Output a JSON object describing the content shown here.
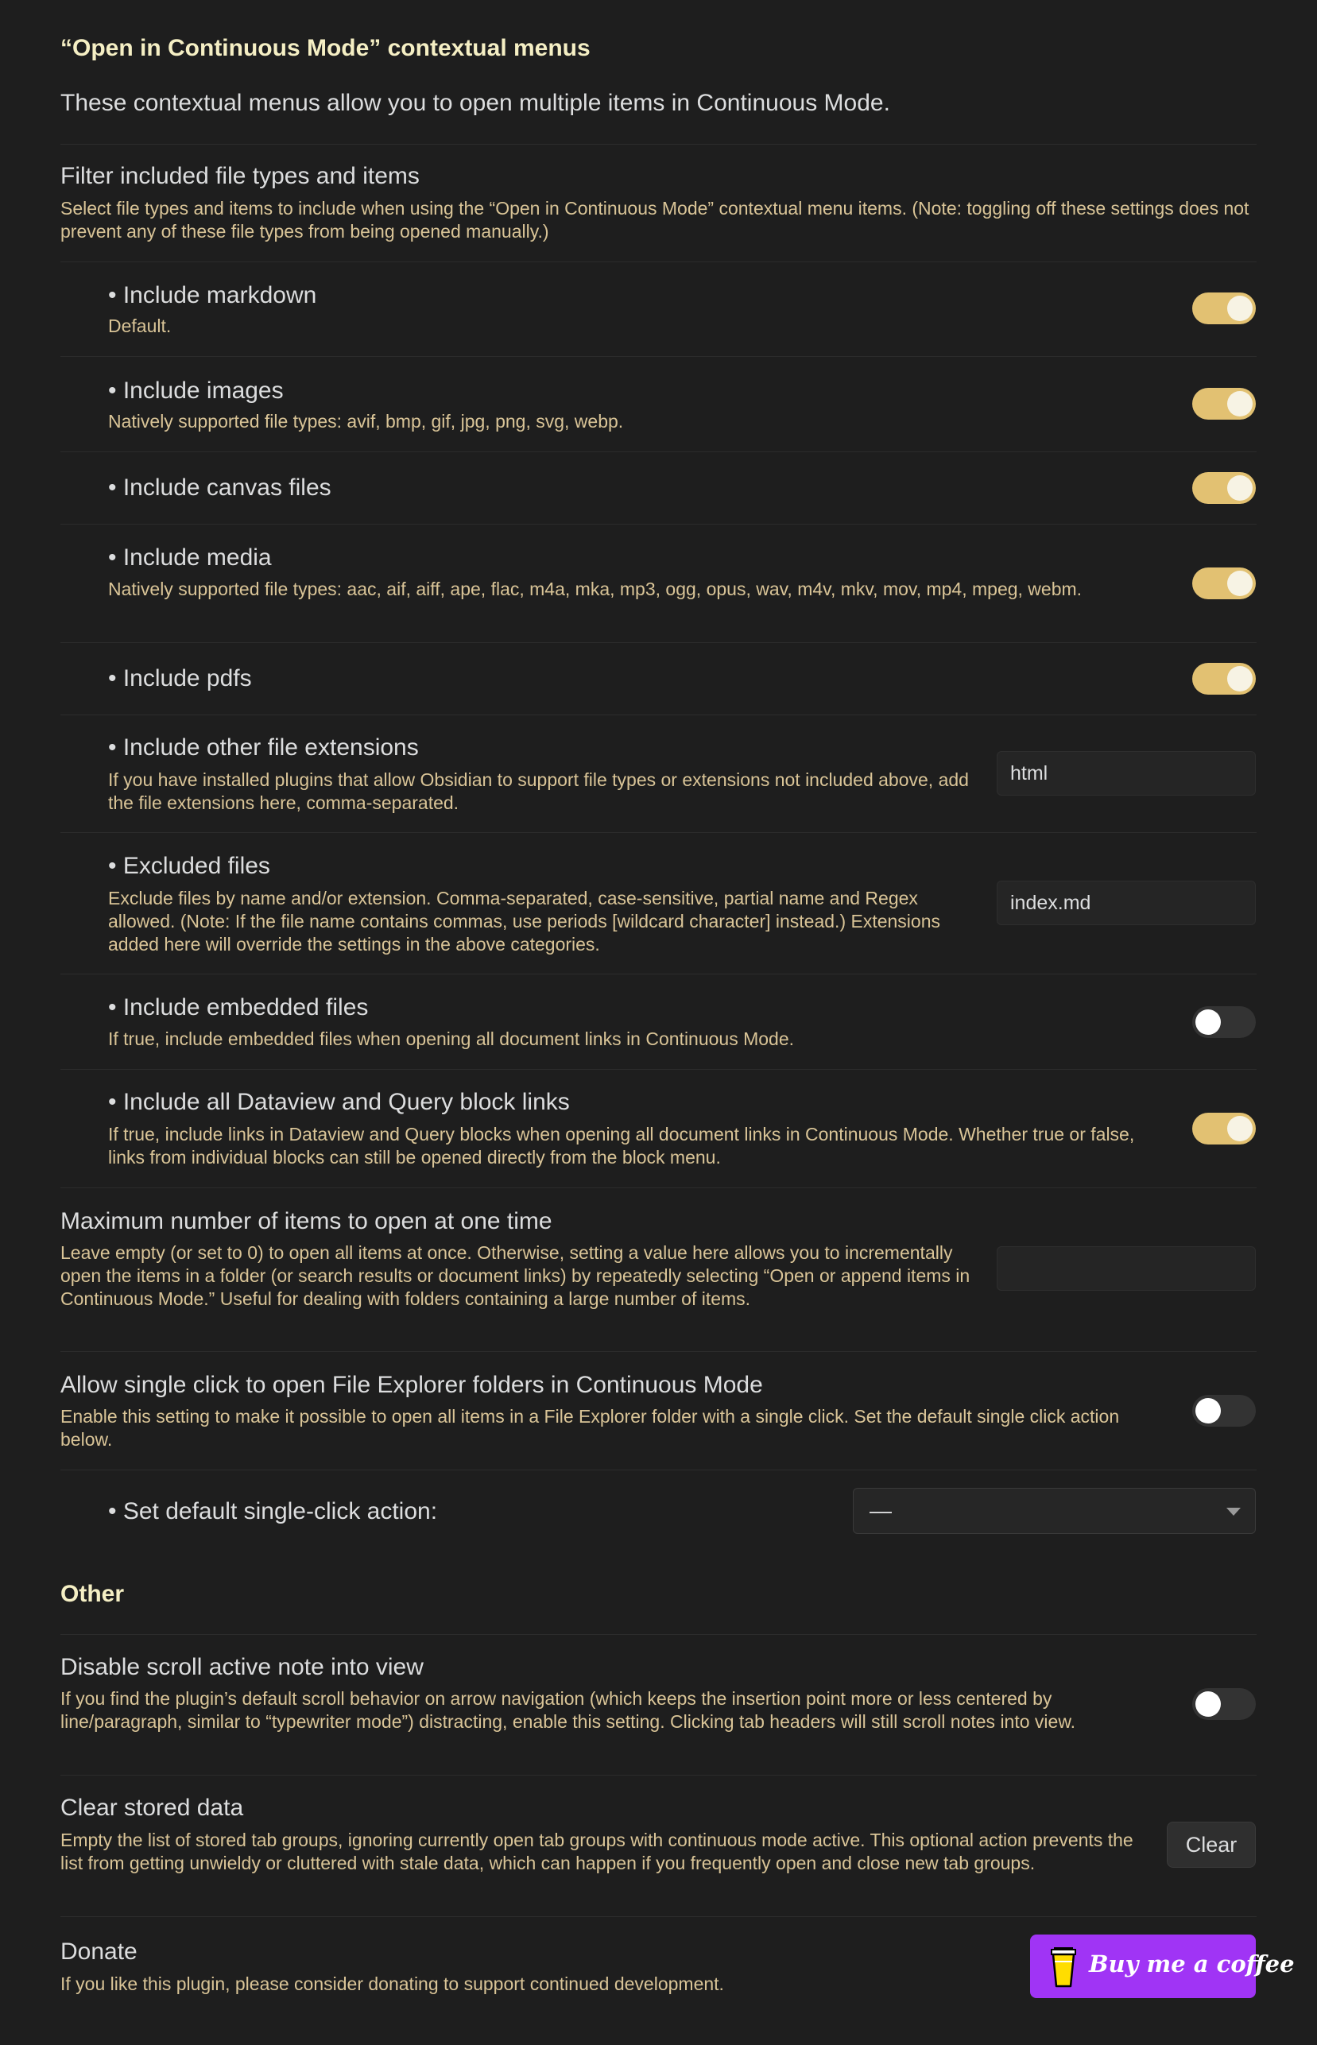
{
  "section1": {
    "heading": "“Open in Continuous Mode” contextual menus",
    "intro": "These contextual menus allow you to open multiple items in Continuous Mode."
  },
  "filter": {
    "title": "Filter included file types and items",
    "desc": "Select file types and items to include when using the “Open in Continuous Mode” contextual menu items. (Note: toggling off these settings does not prevent any of these file types from being opened manually.)"
  },
  "items": {
    "markdown": {
      "title": "• Include markdown",
      "desc": "Default.",
      "on": true
    },
    "images": {
      "title": "• Include images",
      "desc": "Natively supported file types: avif, bmp, gif, jpg, png, svg, webp.",
      "on": true
    },
    "canvas": {
      "title": "• Include canvas files",
      "on": true
    },
    "media": {
      "title": "• Include media",
      "desc": "Natively supported file types: aac, aif, aiff, ape, flac, m4a, mka, mp3, ogg, opus, wav, m4v, mkv, mov, mp4, mpeg, webm.",
      "on": true
    },
    "pdfs": {
      "title": "• Include pdfs",
      "on": true
    },
    "other_ext": {
      "title": "• Include other file extensions",
      "desc": "If you have installed plugins that allow Obsidian to support file types or extensions not included above, add the file extensions here, comma-separated.",
      "value": "html"
    },
    "excluded": {
      "title": "• Excluded files",
      "desc": "Exclude files by name and/or extension. Comma-separated, case-sensitive, partial name and Regex allowed. (Note: If the file name contains commas, use periods [wildcard character] instead.) Extensions added here will override the settings in the above categories.",
      "value": "index.md"
    },
    "embedded": {
      "title": "• Include embedded files",
      "desc": "If true, include embedded files when opening all document links in Continuous Mode.",
      "on": false
    },
    "dataview": {
      "title": "• Include all Dataview and Query block links",
      "desc": "If true, include links in Dataview and Query blocks when opening all document links in Continuous Mode. Whether true or false, links from individual blocks can still be opened directly from the block menu.",
      "on": true
    }
  },
  "max_items": {
    "title": "Maximum number of items to open at one time",
    "desc": "Leave empty (or set to 0) to open all items at once. Otherwise, setting a value here allows you to incrementally open the items in a folder (or search results or document links) by repeatedly selecting “Open or append items in Continuous Mode.” Useful for dealing with folders containing a large number of items.",
    "value": ""
  },
  "single_click": {
    "title": "Allow single click to open File Explorer folders in Continuous Mode",
    "desc": "Enable this setting to make it possible to open all items in a File Explorer folder with a single click. Set the default single click action below.",
    "on": false
  },
  "default_action": {
    "title": "• Set default single-click action:",
    "selected": "—"
  },
  "other": {
    "heading": "Other"
  },
  "scroll": {
    "title": "Disable scroll active note into view",
    "desc": "If you find the plugin’s default scroll behavior on arrow navigation (which keeps the insertion point more or less centered by line/paragraph, similar to “typewriter mode”) distracting, enable this setting. Clicking tab headers will still scroll notes into view.",
    "on": false
  },
  "clear": {
    "title": "Clear stored data",
    "desc": "Empty the list of stored tab groups, ignoring currently open tab groups with continuous mode active. This optional action prevents the list from getting unwieldy or cluttered with stale data, which can happen if you frequently open and close new tab groups.",
    "button": "Clear"
  },
  "donate": {
    "title": "Donate",
    "desc": "If you like this plugin, please consider donating to support continued development.",
    "button": "Buy me a coffee"
  },
  "colors": {
    "background": "#1e1e1e",
    "heading": "#f5efc4",
    "description": "#d9c497",
    "toggle_on": "#e2c172",
    "donate_button": "#a034f5"
  }
}
